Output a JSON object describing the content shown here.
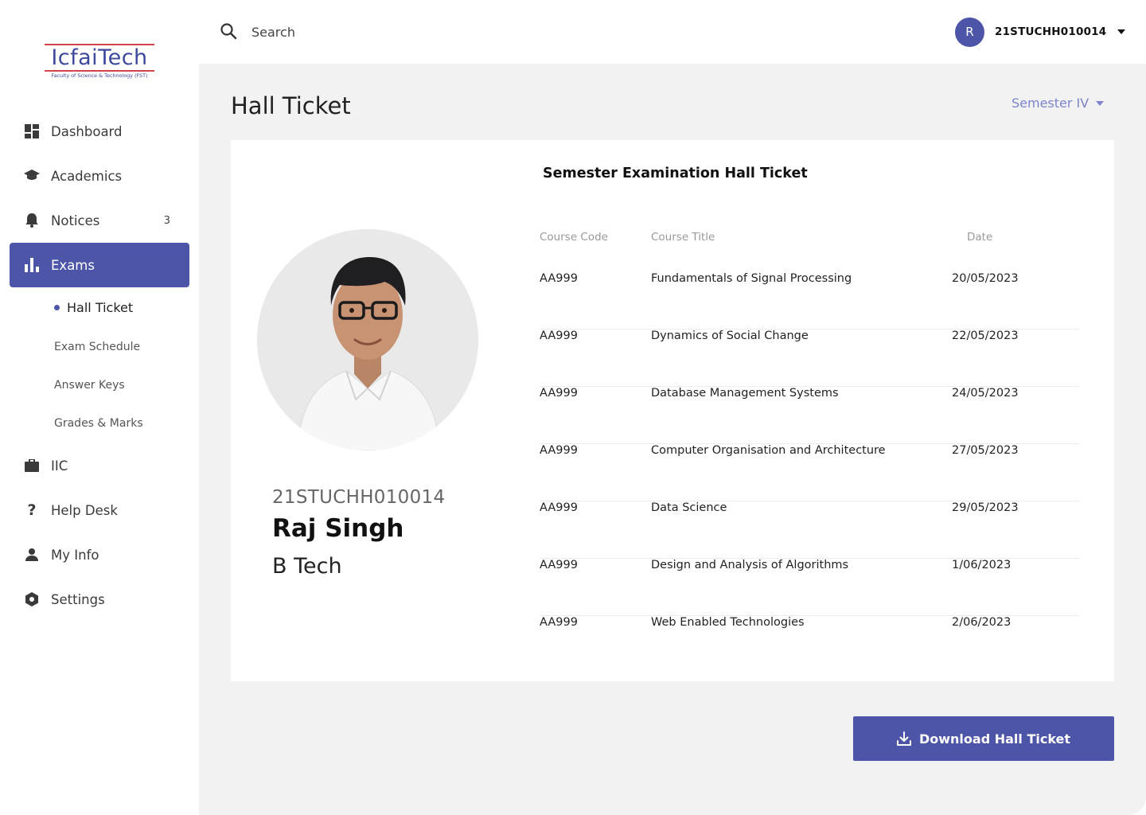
{
  "logo": {
    "name": "IcfaiTech",
    "subtitle": "Faculty of Science & Technology (FST)"
  },
  "colors": {
    "accent": "#4d55a9",
    "accent_light": "#7c84cc",
    "background": "#f2f2f2"
  },
  "sidebar": {
    "items": [
      {
        "label": "Dashboard",
        "icon": "dashboard-icon"
      },
      {
        "label": "Academics",
        "icon": "graduation-cap-icon"
      },
      {
        "label": "Notices",
        "icon": "bell-icon",
        "badge": "3"
      },
      {
        "label": "Exams",
        "icon": "bar-chart-icon",
        "active": true
      },
      {
        "label": "IIC",
        "icon": "briefcase-icon"
      },
      {
        "label": "Help Desk",
        "icon": "question-icon"
      },
      {
        "label": "My Info",
        "icon": "user-icon"
      },
      {
        "label": "Settings",
        "icon": "settings-icon"
      }
    ],
    "exam_subitems": [
      "Hall Ticket",
      "Exam Schedule",
      "Answer Keys",
      "Grades & Marks"
    ]
  },
  "header": {
    "search_placeholder": "Search",
    "avatar_letter": "R",
    "user_id": "21STUCHH010014"
  },
  "main": {
    "title": "Hall Ticket",
    "semester": "Semester IV",
    "card": {
      "title": "Semester Examination Hall Ticket",
      "student": {
        "id": "21STUCHH010014",
        "name": "Raj Singh",
        "program": "B Tech"
      },
      "columns": [
        "Course Code",
        "Course Title",
        "Date"
      ],
      "rows": [
        {
          "code": "AA999",
          "title": "Fundamentals of Signal Processing",
          "date": "20/05/2023"
        },
        {
          "code": "AA999",
          "title": "Dynamics of Social Change",
          "date": "22/05/2023"
        },
        {
          "code": "AA999",
          "title": "Database Management Systems",
          "date": "24/05/2023"
        },
        {
          "code": "AA999",
          "title": "Computer Organisation and Architecture",
          "date": "27/05/2023"
        },
        {
          "code": "AA999",
          "title": "Data Science",
          "date": "29/05/2023"
        },
        {
          "code": "AA999",
          "title": "Design and Analysis of Algorithms",
          "date": "1/06/2023"
        },
        {
          "code": "AA999",
          "title": "Web Enabled Technologies",
          "date": "2/06/2023"
        }
      ]
    },
    "download_label": "Download Hall Ticket"
  }
}
